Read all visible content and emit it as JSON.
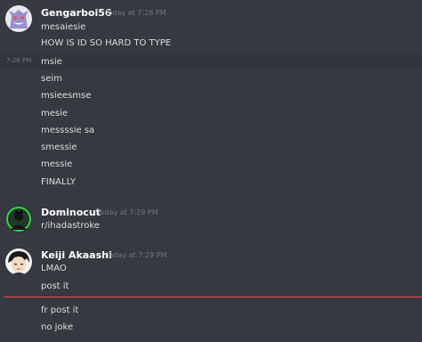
{
  "colors": {
    "background": "#36393f",
    "username": "#ffffff",
    "message_text": "#dcddde",
    "timestamp": "#72767d",
    "new_messages_divider": "#f04747"
  },
  "groups": [
    {
      "author": "Gengarboi56",
      "timestamp": "Today at 7:28 PM",
      "avatar_icon": "gengar-avatar-icon",
      "messages": [
        "mesaiesie",
        "HOW IS ID SO HARD TO TYPE"
      ]
    },
    {
      "hover_timestamp": "7:28 PM",
      "messages": [
        "msie",
        "seim",
        "msieesmse",
        "mesie",
        "messssie sa",
        "smessie",
        "messie",
        "FINALLY"
      ]
    },
    {
      "author": "Dominocut",
      "timestamp": "Today at 7:29 PM",
      "avatar_icon": "dominocut-avatar-icon",
      "messages": [
        "r/ihadastroke"
      ]
    },
    {
      "author": "Keiji Akaashi",
      "timestamp": "Today at 7:29 PM",
      "avatar_icon": "keiji-avatar-icon",
      "messages": [
        "LMAO",
        "post it"
      ]
    },
    {
      "messages": [
        "fr post it",
        "no joke"
      ]
    }
  ]
}
